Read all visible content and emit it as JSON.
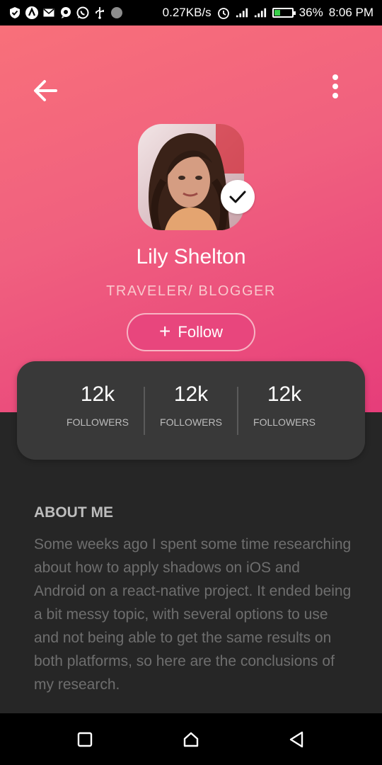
{
  "status_bar": {
    "network_speed": "0.27KB/s",
    "battery_percent": "36%",
    "battery_level": 0.36,
    "time": "8:06 PM",
    "left_icons": [
      "shield-icon",
      "app-a-icon",
      "mail-icon",
      "chat-icon",
      "whatsapp-icon",
      "usb-icon",
      "circle-icon"
    ],
    "right_icons": [
      "alarm-icon",
      "signal-icon",
      "signal-icon",
      "battery-icon"
    ]
  },
  "profile": {
    "name": "Lily Shelton",
    "role": "TRAVELER/ BLOGGER",
    "follow_label": "Follow",
    "verified": true
  },
  "stats": [
    {
      "value": "12k",
      "label": "FOLLOWERS"
    },
    {
      "value": "12k",
      "label": "FOLLOWERS"
    },
    {
      "value": "12k",
      "label": "FOLLOWERS"
    }
  ],
  "about": {
    "title": "ABOUT ME",
    "text": "Some weeks ago I spent some time researching about how to apply shadows on iOS and Android on a react-native project. It ended being a bit messy topic, with several options to use and not being able to get the same results on both platforms, so here are the conclusions of my research."
  },
  "colors": {
    "header_gradient_start": "#f8707a",
    "header_gradient_end": "#e63d7a",
    "background": "#262626",
    "card": "#393939",
    "follow_button": "#e8467d"
  }
}
